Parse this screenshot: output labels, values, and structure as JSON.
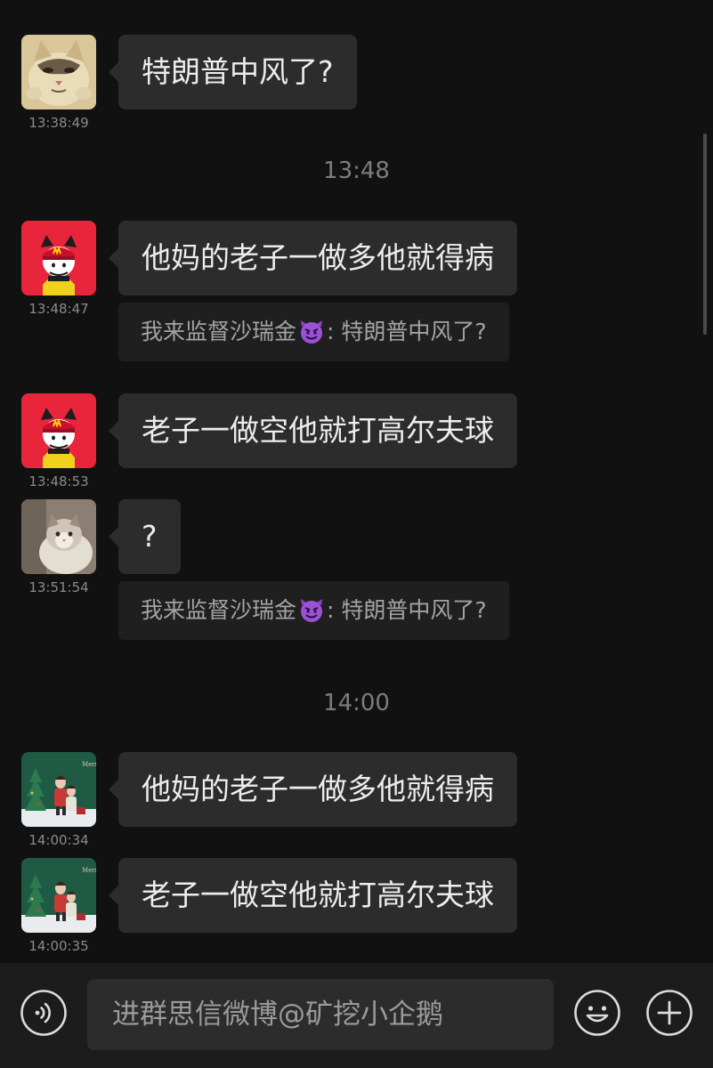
{
  "chat": {
    "dividers": [
      "13:48",
      "14:00"
    ],
    "messages": [
      {
        "time": "13:38:49",
        "text": "特朗普中风了?",
        "avatar": "cat-illustration-avatar"
      },
      {
        "time": "13:48:47",
        "text": "他妈的老子一做多他就得病",
        "avatar": "red-cat-cap-avatar",
        "quote": {
          "sender": "我来监督沙瑞金",
          "emoji": "smiling-devil-emoji",
          "separator": ":",
          "text": "特朗普中风了?"
        }
      },
      {
        "time": "13:48:53",
        "text": "老子一做空他就打高尔夫球",
        "avatar": "red-cat-cap-avatar"
      },
      {
        "time": "13:51:54",
        "text": "?",
        "avatar": "fluffy-cat-photo-avatar",
        "quote": {
          "sender": "我来监督沙瑞金",
          "emoji": "smiling-devil-emoji",
          "separator": ":",
          "text": "特朗普中风了?"
        }
      },
      {
        "time": "14:00:34",
        "text": "他妈的老子一做多他就得病",
        "avatar": "christmas-kids-photo-avatar"
      },
      {
        "time": "14:00:35",
        "text": "老子一做空他就打高尔夫球",
        "avatar": "christmas-kids-photo-avatar"
      }
    ]
  },
  "input_bar": {
    "text": "进群思信微博@矿挖小企鹅",
    "voice_icon": "voice-icon",
    "emoji_icon": "emoji-icon",
    "add_icon": "plus-icon"
  },
  "colors": {
    "background": "#111111",
    "bubble": "#2c2c2c",
    "quote": "#1f1f1f",
    "input_bar": "#1c1c1c",
    "red_avatar": "#e8253a"
  }
}
